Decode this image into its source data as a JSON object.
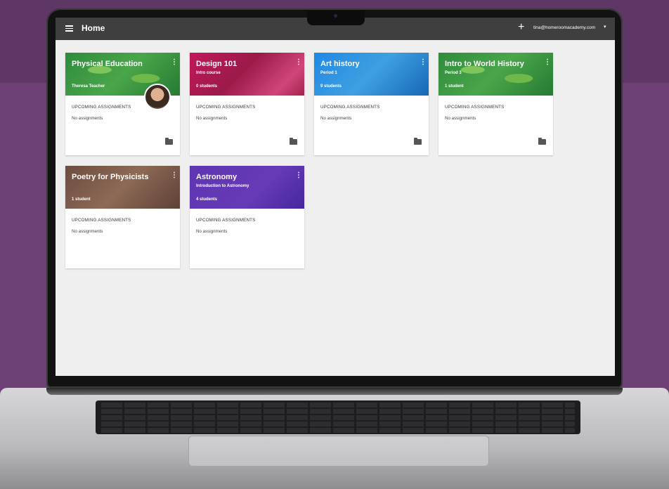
{
  "appbar": {
    "title": "Home",
    "plus_icon": "+",
    "account": "tina@homeroomacademy.com",
    "caret_icon": "▾"
  },
  "cards": [
    {
      "title": "Physical Education",
      "subtitle": "",
      "teacher": "Theresa Teacher",
      "count": "",
      "header_color": "#2e8b3a",
      "upcoming": "UPCOMING ASSIGNMENTS",
      "assignments": "No assignments",
      "folder": true
    },
    {
      "title": "Design 101",
      "subtitle": "Intro course",
      "teacher": "",
      "count": "0 students",
      "header_color": "#c2185b",
      "upcoming": "UPCOMING ASSIGNMENTS",
      "assignments": "No assignments",
      "folder": true
    },
    {
      "title": "Art history",
      "subtitle": "Period 1",
      "teacher": "",
      "count": "9 students",
      "header_color": "#1e88e5",
      "upcoming": "UPCOMING ASSIGNMENTS",
      "assignments": "No assignments",
      "folder": true
    },
    {
      "title": "Intro to World History",
      "subtitle": "Period 3",
      "teacher": "",
      "count": "1 student",
      "header_color": "#2e8b3a",
      "upcoming": "UPCOMING ASSIGNMENTS",
      "assignments": "No assignments",
      "folder": true
    },
    {
      "title": "Poetry for Physicists",
      "subtitle": "",
      "teacher": "",
      "count": "1 student",
      "header_color": "#6d4c41",
      "upcoming": "UPCOMING ASSIGNMENTS",
      "assignments": "No assignments",
      "folder": false
    },
    {
      "title": "Astronomy",
      "subtitle": "Introduction to Astronomy",
      "teacher": "",
      "count": "4 students",
      "header_color": "#5e35b1",
      "upcoming": "UPCOMING ASSIGNMENTS",
      "assignments": "No assignments",
      "folder": false
    }
  ],
  "kebab_icon": "⋮"
}
